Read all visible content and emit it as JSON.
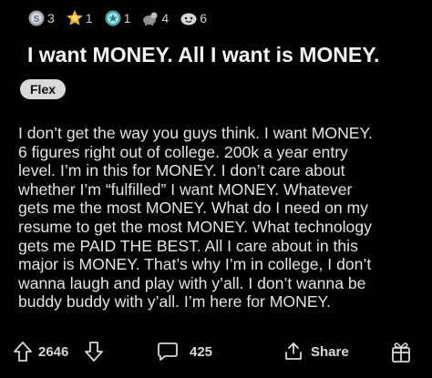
{
  "awards": [
    {
      "icon": "silver-award-icon",
      "count": "3",
      "color": "#b9c2cc"
    },
    {
      "icon": "gold-award-icon",
      "count": "1",
      "color": "#e8b53a"
    },
    {
      "icon": "platinum-award-icon",
      "count": "1",
      "color": "#7fd3d6"
    },
    {
      "icon": "helpful-award-icon",
      "count": "4",
      "color": "#c8c8c8"
    },
    {
      "icon": "wholesome-award-icon",
      "count": "6",
      "color": "#c8c8c8"
    }
  ],
  "post": {
    "title": "I want MONEY. All I want is MONEY.",
    "flair": "Flex",
    "body_lines": [
      "I don’t get the way you guys think. I want MONEY.",
      "6 figures right out of college. 200k a year entry",
      "level. I’m in this for MONEY. I don’t care about",
      "whether I’m “fulfilled” I want MONEY. Whatever",
      "gets me the most MONEY. What do I need on my",
      "resume to get the most MONEY. What technology",
      "gets me PAID THE BEST. All I care about in this",
      "major is MONEY. That’s why I’m in college, I don’t",
      "wanna laugh and play with y’all. I don’t wanna be",
      "buddy buddy with y’all. I’m here for MONEY."
    ]
  },
  "actions": {
    "upvote_icon": "upvote-arrow-icon",
    "vote_count": "2646",
    "downvote_icon": "downvote-arrow-icon",
    "comment_icon": "comment-bubble-icon",
    "comment_count": "425",
    "share_icon": "share-icon",
    "share_label": "Share",
    "award_icon": "give-award-icon"
  },
  "colors": {
    "background": "#000000",
    "text": "#e4e4e4",
    "flair_bg": "#d9d9d9"
  }
}
